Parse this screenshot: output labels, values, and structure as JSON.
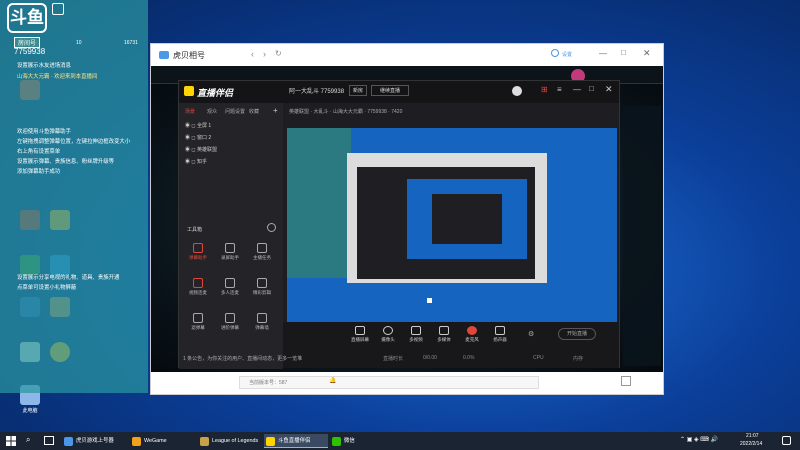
{
  "chat": {
    "logo_text": "斗鱼",
    "badge": "房间号",
    "room_id": "7759938",
    "counts": [
      "10",
      "16731"
    ],
    "messages": [
      "设置展示水友进场消息",
      "山海大大元霸 · 欢迎来到本直播间",
      "欢迎使用斗鱼弹幕助手",
      "左键拖拽调整弹幕位置，左键拉伸边框改变大小",
      "右上角有设置菜单",
      "设置展示弹幕、贵族信息、粉丝牌升级等",
      "添加弹幕助手成功",
      "设置展示分享电视的礼物、道具、贵族开通",
      "点菜单可设置小礼物屏蔽"
    ]
  },
  "desktop_icons": [
    "",
    "",
    "",
    "",
    "",
    "",
    "",
    "",
    "",
    "此电脑"
  ],
  "huya": {
    "title": "虎贝相号",
    "footer_text": "当前版本号：587",
    "user_btn": "设置"
  },
  "app": {
    "title": "直播伴侣",
    "tabs": [
      "场景",
      "观众",
      "问题设置",
      "收藏"
    ],
    "layers": [
      "全屏 1",
      "窗口 2",
      "英雄联盟",
      "知乎"
    ],
    "streamer": "阿一大乱斗 7759938",
    "tag1": "新房",
    "tag2": "继续直播",
    "subline": "英雄联盟 · 大乱斗 · 山海大大元霸 · 7759938 · 7420",
    "tools_title": "工具箱",
    "tools": [
      "弹幕助手",
      "录屏助手",
      "主播任务",
      "视频连麦",
      "多人连麦",
      "精彩剪辑",
      "滤弹幕",
      "进阶弹幕",
      "弹幕墙"
    ],
    "controls": [
      "直播屏幕",
      "摄像头",
      "多视频",
      "多媒体",
      "麦克风",
      "扬声器"
    ],
    "start_button": "开始直播",
    "status": "1 条公告，为你关注的用户、直播间动态，更多一览堆",
    "stats": [
      "直播时长",
      "0/0.00",
      "0.0%",
      "CPU",
      "内存"
    ]
  },
  "taskbar": {
    "tasks": [
      "虎贝游戏上号器",
      "WeGame",
      "League of Legends",
      "斗鱼直播伴侣",
      "微信"
    ],
    "time": "21:07",
    "date": "2022/2/14"
  },
  "colors": {
    "chat_bg": "#2a96a0",
    "preview_blue": "#1565c0",
    "accent_red": "#e0463a",
    "taskbar": "#1b2432"
  }
}
